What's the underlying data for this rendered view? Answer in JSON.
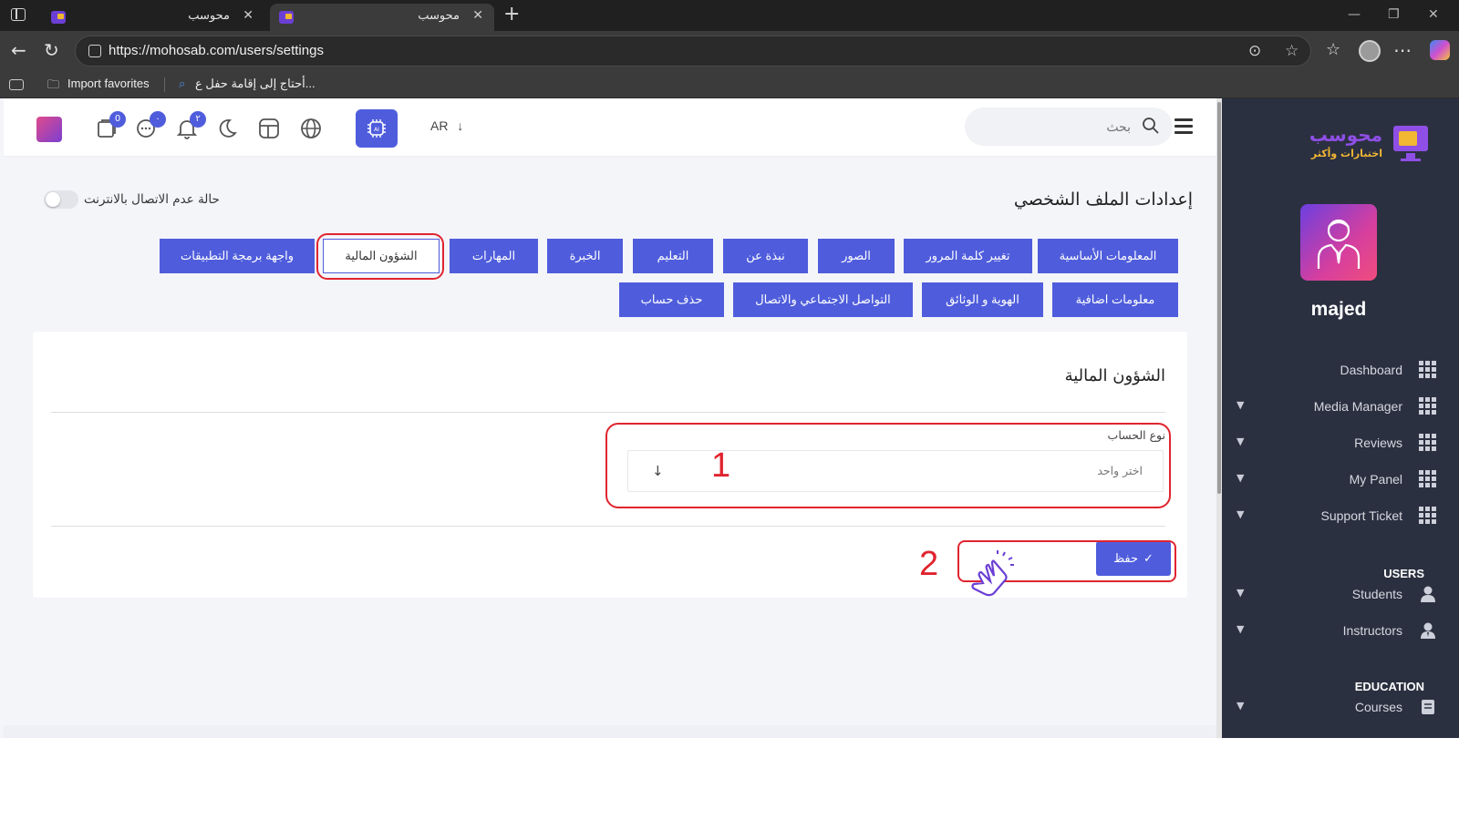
{
  "browser": {
    "tabs": [
      {
        "title": "محوسب",
        "active": false
      },
      {
        "title": "محوسب",
        "active": true
      }
    ],
    "url": "https://mohosab.com/users/settings",
    "favorites": [
      {
        "label": "Import favorites"
      },
      {
        "label": "أحتاج إلى إقامة حفل ع..."
      }
    ]
  },
  "topbar": {
    "language": "AR",
    "search_placeholder": "بحث",
    "badges": {
      "notes": "0",
      "messages": "٠",
      "notifications": "٢"
    }
  },
  "page": {
    "title": "إعدادات الملف الشخصي",
    "offline_toggle_label": "حالة عدم الاتصال بالانترنت",
    "tabs_row1": [
      "المعلومات الأساسية",
      "تغيير كلمة المرور",
      "الصور",
      "نبذة عن",
      "التعليم",
      "الخبرة",
      "المهارات",
      "الشؤون المالية",
      "واجهة برمجة التطبيقات"
    ],
    "tabs_row2": [
      "معلومات اضافية",
      "الهوية و الوثائق",
      "التواصل الاجتماعي والاتصال",
      "حذف حساب"
    ],
    "active_tab": "الشؤون المالية"
  },
  "card": {
    "title": "الشؤون المالية",
    "account_type_label": "نوع الحساب",
    "account_type_placeholder": "اختر واحد",
    "save_label": "حفظ",
    "annotation_1": "1",
    "annotation_2": "2"
  },
  "sidebar": {
    "logo_title": "محوسب",
    "logo_subtitle": "اختبارات وأكثر",
    "username": "majed",
    "items": [
      {
        "label": "Dashboard",
        "caret": false
      },
      {
        "label": "Media Manager",
        "caret": true
      },
      {
        "label": "Reviews",
        "caret": true
      },
      {
        "label": "My Panel",
        "caret": true
      },
      {
        "label": "Support Ticket",
        "caret": true
      }
    ],
    "users_header": "USERS",
    "users_items": [
      {
        "label": "Students"
      },
      {
        "label": "Instructors"
      }
    ],
    "education_header": "EDUCATION",
    "education_items": [
      {
        "label": "Courses"
      }
    ]
  },
  "colors": {
    "accent": "#4f5ddc",
    "sidebar_bg": "#2b3040",
    "annotation_red": "#e0242f"
  }
}
